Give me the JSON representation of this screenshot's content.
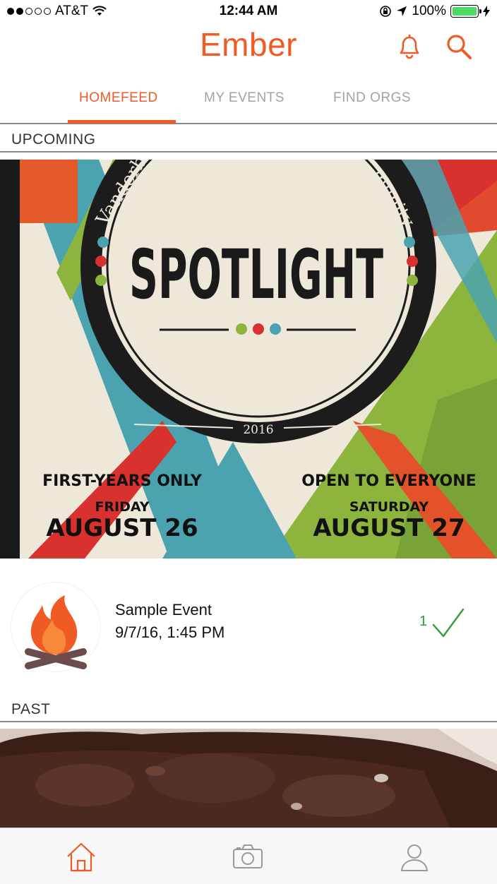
{
  "status_bar": {
    "carrier": "AT&T",
    "time": "12:44 AM",
    "battery_percent": "100%",
    "battery_level": 1.0
  },
  "header": {
    "title": "Ember",
    "accent_color": "#f05a24",
    "icons": [
      "bell-icon",
      "search-icon"
    ]
  },
  "tabs": [
    {
      "label": "HOMEFEED",
      "active": true
    },
    {
      "label": "MY EVENTS",
      "active": false
    },
    {
      "label": "FIND ORGS",
      "active": false
    }
  ],
  "sections": {
    "upcoming": "UPCOMING",
    "past": "PAST"
  },
  "poster": {
    "arc_left": "Vanderb",
    "arc_right": "munity",
    "title": "SPOTLIGHT",
    "year": "2016",
    "left_audience": "FIRST-YEARS ONLY",
    "left_day": "FRIDAY",
    "left_date": "AUGUST 26",
    "right_audience": "OPEN TO EVERYONE",
    "right_day": "SATURDAY",
    "right_date": "AUGUST 27"
  },
  "event": {
    "name": "Sample Event",
    "datetime": "9/7/16, 1:45 PM",
    "rsvp_count": "1",
    "rsvp_color": "#2e9e3a"
  },
  "tabbar": {
    "icons": [
      "home-icon",
      "camera-icon",
      "profile-icon"
    ],
    "active": "home-icon"
  }
}
